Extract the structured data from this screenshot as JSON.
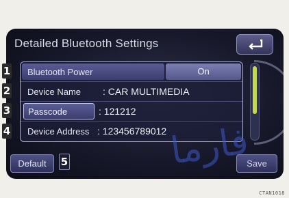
{
  "screen": {
    "title": "Detailed Bluetooth Settings"
  },
  "rows": [
    {
      "label": "Bluetooth Power",
      "value": "On"
    },
    {
      "label": "Device Name",
      "value": ": CAR MULTIMEDIA"
    },
    {
      "label": "Passcode",
      "value": ": 121212"
    },
    {
      "label": "Device Address",
      "value": ": 123456789012"
    }
  ],
  "callouts": [
    "1",
    "2",
    "3",
    "4",
    "5"
  ],
  "buttons": {
    "default_label": "Default",
    "save_label": "Save"
  },
  "watermark_text": "فارما",
  "colors": {
    "screen_bg": "#17182a",
    "accent_border": "#a9acd6",
    "scroll_thumb": "#c4d94a"
  },
  "icons": {
    "back": "return-arrow-icon"
  },
  "corner_code": "CTAN1018"
}
